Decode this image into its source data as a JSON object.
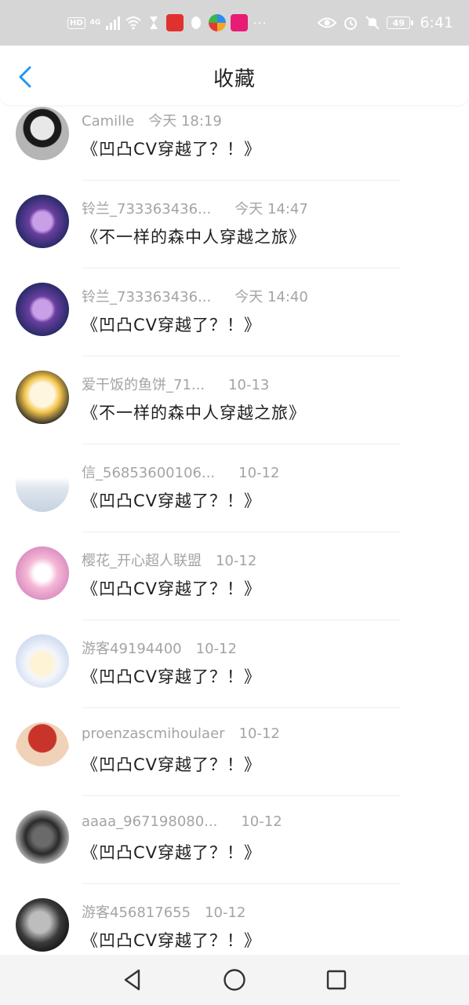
{
  "status_bar": {
    "network_badge": "HD",
    "signal_type": "4G",
    "battery": "49",
    "time": "6:41",
    "dots": "···"
  },
  "header": {
    "title": "收藏",
    "back_icon": "chevron-left-icon",
    "accent": "#2196f3"
  },
  "items": [
    {
      "user": "Camille",
      "time": "今天 18:19",
      "book": "《凹凸CV穿越了？！》"
    },
    {
      "user": "铃兰_733363436...",
      "time": "今天 14:47",
      "book": "《不一样的森中人穿越之旅》"
    },
    {
      "user": "铃兰_733363436...",
      "time": "今天 14:40",
      "book": "《凹凸CV穿越了？！》"
    },
    {
      "user": "爱干饭的鱼饼_71...",
      "time": "10-13",
      "book": "《不一样的森中人穿越之旅》"
    },
    {
      "user": "信_56853600106...",
      "time": "10-12",
      "book": "《凹凸CV穿越了？！》"
    },
    {
      "user": "樱花_开心超人联盟",
      "time": "10-12",
      "book": "《凹凸CV穿越了？！》"
    },
    {
      "user": "游客49194400",
      "time": "10-12",
      "book": "《凹凸CV穿越了？！》"
    },
    {
      "user": "proenzascmihoulaer",
      "time": "10-12",
      "book": "《凹凸CV穿越了？！》"
    },
    {
      "user": "aaaa_967198080...",
      "time": "10-12",
      "book": "《凹凸CV穿越了？！》"
    },
    {
      "user": "游客456817655",
      "time": "10-12",
      "book": "《凹凸CV穿越了？！》"
    }
  ],
  "nav": {
    "back": "triangle-back-icon",
    "home": "circle-home-icon",
    "recents": "square-recents-icon"
  }
}
